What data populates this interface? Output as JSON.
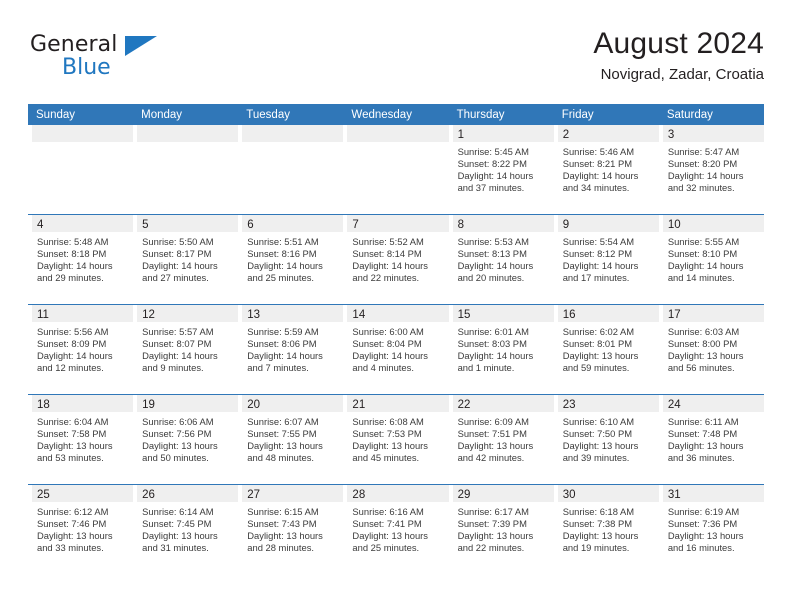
{
  "brand": {
    "name_part1": "General",
    "name_part2": "Blue",
    "accent_color": "#2077c0"
  },
  "header": {
    "title": "August 2024",
    "subtitle": "Novigrad, Zadar, Croatia"
  },
  "calendar": {
    "header_color": "#3077b8",
    "daynum_band_color": "#efefef",
    "weekdays": [
      "Sunday",
      "Monday",
      "Tuesday",
      "Wednesday",
      "Thursday",
      "Friday",
      "Saturday"
    ],
    "weeks": [
      [
        {
          "day": "",
          "empty": true
        },
        {
          "day": "",
          "empty": true
        },
        {
          "day": "",
          "empty": true
        },
        {
          "day": "",
          "empty": true
        },
        {
          "day": "1",
          "sunrise": "Sunrise: 5:45 AM",
          "sunset": "Sunset: 8:22 PM",
          "daylight1": "Daylight: 14 hours",
          "daylight2": "and 37 minutes."
        },
        {
          "day": "2",
          "sunrise": "Sunrise: 5:46 AM",
          "sunset": "Sunset: 8:21 PM",
          "daylight1": "Daylight: 14 hours",
          "daylight2": "and 34 minutes."
        },
        {
          "day": "3",
          "sunrise": "Sunrise: 5:47 AM",
          "sunset": "Sunset: 8:20 PM",
          "daylight1": "Daylight: 14 hours",
          "daylight2": "and 32 minutes."
        }
      ],
      [
        {
          "day": "4",
          "sunrise": "Sunrise: 5:48 AM",
          "sunset": "Sunset: 8:18 PM",
          "daylight1": "Daylight: 14 hours",
          "daylight2": "and 29 minutes."
        },
        {
          "day": "5",
          "sunrise": "Sunrise: 5:50 AM",
          "sunset": "Sunset: 8:17 PM",
          "daylight1": "Daylight: 14 hours",
          "daylight2": "and 27 minutes."
        },
        {
          "day": "6",
          "sunrise": "Sunrise: 5:51 AM",
          "sunset": "Sunset: 8:16 PM",
          "daylight1": "Daylight: 14 hours",
          "daylight2": "and 25 minutes."
        },
        {
          "day": "7",
          "sunrise": "Sunrise: 5:52 AM",
          "sunset": "Sunset: 8:14 PM",
          "daylight1": "Daylight: 14 hours",
          "daylight2": "and 22 minutes."
        },
        {
          "day": "8",
          "sunrise": "Sunrise: 5:53 AM",
          "sunset": "Sunset: 8:13 PM",
          "daylight1": "Daylight: 14 hours",
          "daylight2": "and 20 minutes."
        },
        {
          "day": "9",
          "sunrise": "Sunrise: 5:54 AM",
          "sunset": "Sunset: 8:12 PM",
          "daylight1": "Daylight: 14 hours",
          "daylight2": "and 17 minutes."
        },
        {
          "day": "10",
          "sunrise": "Sunrise: 5:55 AM",
          "sunset": "Sunset: 8:10 PM",
          "daylight1": "Daylight: 14 hours",
          "daylight2": "and 14 minutes."
        }
      ],
      [
        {
          "day": "11",
          "sunrise": "Sunrise: 5:56 AM",
          "sunset": "Sunset: 8:09 PM",
          "daylight1": "Daylight: 14 hours",
          "daylight2": "and 12 minutes."
        },
        {
          "day": "12",
          "sunrise": "Sunrise: 5:57 AM",
          "sunset": "Sunset: 8:07 PM",
          "daylight1": "Daylight: 14 hours",
          "daylight2": "and 9 minutes."
        },
        {
          "day": "13",
          "sunrise": "Sunrise: 5:59 AM",
          "sunset": "Sunset: 8:06 PM",
          "daylight1": "Daylight: 14 hours",
          "daylight2": "and 7 minutes."
        },
        {
          "day": "14",
          "sunrise": "Sunrise: 6:00 AM",
          "sunset": "Sunset: 8:04 PM",
          "daylight1": "Daylight: 14 hours",
          "daylight2": "and 4 minutes."
        },
        {
          "day": "15",
          "sunrise": "Sunrise: 6:01 AM",
          "sunset": "Sunset: 8:03 PM",
          "daylight1": "Daylight: 14 hours",
          "daylight2": "and 1 minute."
        },
        {
          "day": "16",
          "sunrise": "Sunrise: 6:02 AM",
          "sunset": "Sunset: 8:01 PM",
          "daylight1": "Daylight: 13 hours",
          "daylight2": "and 59 minutes."
        },
        {
          "day": "17",
          "sunrise": "Sunrise: 6:03 AM",
          "sunset": "Sunset: 8:00 PM",
          "daylight1": "Daylight: 13 hours",
          "daylight2": "and 56 minutes."
        }
      ],
      [
        {
          "day": "18",
          "sunrise": "Sunrise: 6:04 AM",
          "sunset": "Sunset: 7:58 PM",
          "daylight1": "Daylight: 13 hours",
          "daylight2": "and 53 minutes."
        },
        {
          "day": "19",
          "sunrise": "Sunrise: 6:06 AM",
          "sunset": "Sunset: 7:56 PM",
          "daylight1": "Daylight: 13 hours",
          "daylight2": "and 50 minutes."
        },
        {
          "day": "20",
          "sunrise": "Sunrise: 6:07 AM",
          "sunset": "Sunset: 7:55 PM",
          "daylight1": "Daylight: 13 hours",
          "daylight2": "and 48 minutes."
        },
        {
          "day": "21",
          "sunrise": "Sunrise: 6:08 AM",
          "sunset": "Sunset: 7:53 PM",
          "daylight1": "Daylight: 13 hours",
          "daylight2": "and 45 minutes."
        },
        {
          "day": "22",
          "sunrise": "Sunrise: 6:09 AM",
          "sunset": "Sunset: 7:51 PM",
          "daylight1": "Daylight: 13 hours",
          "daylight2": "and 42 minutes."
        },
        {
          "day": "23",
          "sunrise": "Sunrise: 6:10 AM",
          "sunset": "Sunset: 7:50 PM",
          "daylight1": "Daylight: 13 hours",
          "daylight2": "and 39 minutes."
        },
        {
          "day": "24",
          "sunrise": "Sunrise: 6:11 AM",
          "sunset": "Sunset: 7:48 PM",
          "daylight1": "Daylight: 13 hours",
          "daylight2": "and 36 minutes."
        }
      ],
      [
        {
          "day": "25",
          "sunrise": "Sunrise: 6:12 AM",
          "sunset": "Sunset: 7:46 PM",
          "daylight1": "Daylight: 13 hours",
          "daylight2": "and 33 minutes."
        },
        {
          "day": "26",
          "sunrise": "Sunrise: 6:14 AM",
          "sunset": "Sunset: 7:45 PM",
          "daylight1": "Daylight: 13 hours",
          "daylight2": "and 31 minutes."
        },
        {
          "day": "27",
          "sunrise": "Sunrise: 6:15 AM",
          "sunset": "Sunset: 7:43 PM",
          "daylight1": "Daylight: 13 hours",
          "daylight2": "and 28 minutes."
        },
        {
          "day": "28",
          "sunrise": "Sunrise: 6:16 AM",
          "sunset": "Sunset: 7:41 PM",
          "daylight1": "Daylight: 13 hours",
          "daylight2": "and 25 minutes."
        },
        {
          "day": "29",
          "sunrise": "Sunrise: 6:17 AM",
          "sunset": "Sunset: 7:39 PM",
          "daylight1": "Daylight: 13 hours",
          "daylight2": "and 22 minutes."
        },
        {
          "day": "30",
          "sunrise": "Sunrise: 6:18 AM",
          "sunset": "Sunset: 7:38 PM",
          "daylight1": "Daylight: 13 hours",
          "daylight2": "and 19 minutes."
        },
        {
          "day": "31",
          "sunrise": "Sunrise: 6:19 AM",
          "sunset": "Sunset: 7:36 PM",
          "daylight1": "Daylight: 13 hours",
          "daylight2": "and 16 minutes."
        }
      ]
    ]
  }
}
